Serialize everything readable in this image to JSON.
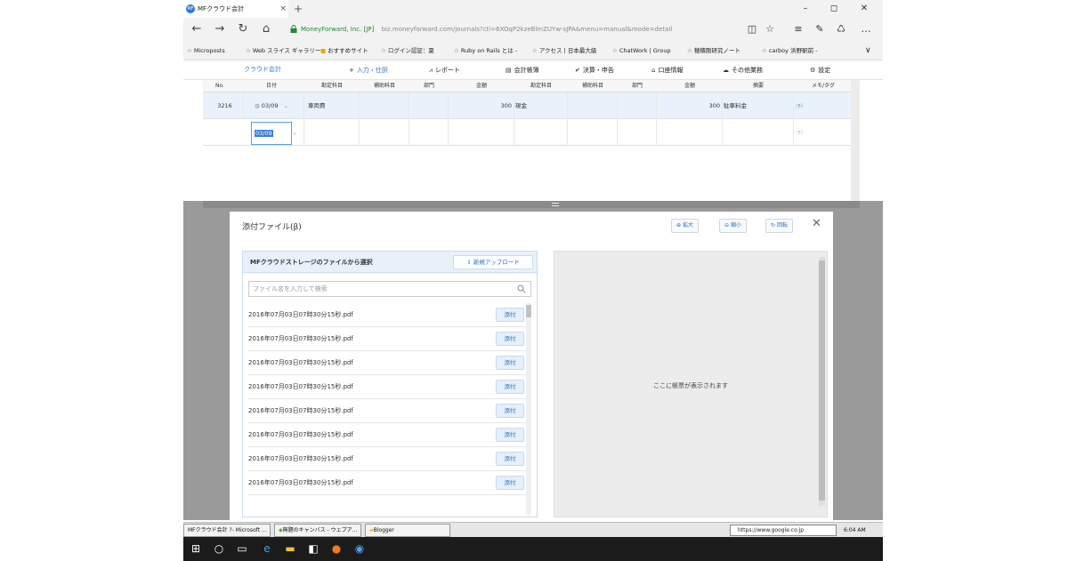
{
  "browser": {
    "tab_title": "MFクラウド会計",
    "favicon_label": "MF",
    "tab_close": "×",
    "new_tab": "+",
    "win_min": "–",
    "win_max": "◻",
    "win_close": "✕",
    "nav_back": "←",
    "nav_forward": "→",
    "nav_refresh": "↻",
    "nav_home": "⌂",
    "site_owner": "MoneyForward, Inc. [JP]",
    "url": "biz.moneyforward.com/journals?cti=6XOqP2kzeBlmZUYw-sJPA&menu=manual&mode=detail",
    "toolbar_icons": [
      "◫",
      "☆",
      "≡",
      "✎",
      "♺",
      "…"
    ],
    "favbar_chevron": "∨",
    "favorites": [
      "Microposts",
      "Web スライス ギャラリー",
      "おすすめサイト",
      "ログイン認証：夏",
      "Ruby on Rails とは -",
      "アクセス | 日本最大級",
      "ChatWork | Group",
      "穂積剛研究ノート",
      "carboy 浜野駅前 -"
    ]
  },
  "app": {
    "logo": "クラウド会計",
    "nav": [
      {
        "icon": "+",
        "label": "入力・仕訳"
      },
      {
        "icon": "⩘",
        "label": "レポート"
      },
      {
        "icon": "▤",
        "label": "会計帳簿"
      },
      {
        "icon": "✔",
        "label": "決算・申告"
      },
      {
        "icon": "⌂",
        "label": "口座情報"
      },
      {
        "icon": "☁",
        "label": "その他業務"
      },
      {
        "icon": "⚙",
        "label": "設定"
      }
    ]
  },
  "grid": {
    "headers": [
      "No.",
      "日付",
      "勘定科目",
      "補助科目",
      "部門",
      "金額",
      "勘定科目",
      "補助科目",
      "部門",
      "金額",
      "摘要",
      "メモ/タグ"
    ],
    "row1": {
      "no": "3216",
      "date": "03/09",
      "debit_account": "車両費",
      "debit_amount": "300",
      "credit_account": "現金",
      "credit_amount": "300",
      "description": "駐車料金"
    },
    "row2": {
      "date": "03/09"
    }
  },
  "modal": {
    "title": "添付ファイル(β)",
    "zoom_in": "拡大",
    "zoom_out": "縮小",
    "rotate": "回転",
    "close": "✕",
    "left_title": "MFクラウドストレージのファイルから選択",
    "upload_label": "新規アップロード",
    "search_placeholder": "ファイル名を入力して検索",
    "attach_label": "添付",
    "files": [
      "2016年07月03日07時30分15秒.pdf",
      "2016年07月03日07時30分15秒.pdf",
      "2016年07月03日07時30分15秒.pdf",
      "2016年07月03日07時30分15秒.pdf",
      "2016年07月03日07時30分15秒.pdf",
      "2016年07月03日07時30分15秒.pdf",
      "2016年07月03日07時30分15秒.pdf",
      "2016年07月03日07時30分15秒.pdf"
    ],
    "preview_placeholder": "ここに帳票が表示されます"
  },
  "taskbar": {
    "items": [
      "MFクラウド会計 ?- Microsoft ...",
      "無題のキャンバス - ウェブア...",
      "Blogger"
    ],
    "url_box": "https://www.google.co.jp",
    "clock": "6:04 AM",
    "win_icons": [
      "⊞",
      "○",
      "▭",
      "e",
      "▬",
      "◧",
      "●",
      "◉"
    ]
  }
}
